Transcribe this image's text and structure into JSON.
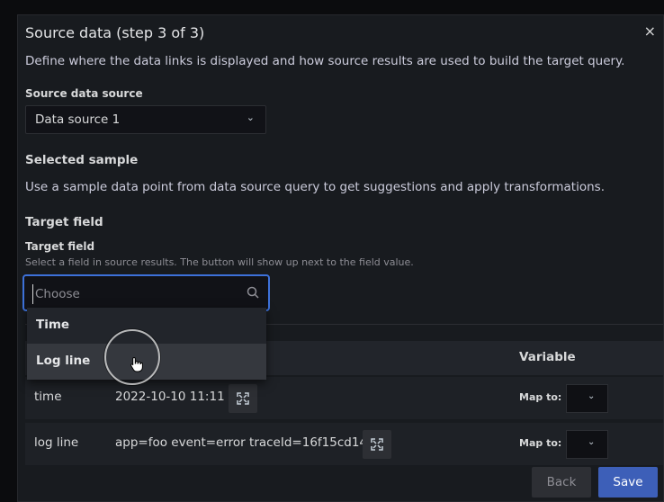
{
  "modal": {
    "title": "Source data (step 3 of 3)",
    "close_label": "×",
    "description": "Define where the data links is displayed and how source results are used to build the target query."
  },
  "source_data_source": {
    "label": "Source data source",
    "selected": "Data source 1"
  },
  "selected_sample": {
    "heading": "Selected sample",
    "text": "Use a sample data point from data source query to get suggestions and apply transformations."
  },
  "target_field": {
    "heading": "Target field",
    "label": "Target field",
    "hint": "Select a field in source results. The button will show up next to the field value.",
    "placeholder": "Choose",
    "options": [
      "Time",
      "Log line"
    ],
    "hovered_option": "Log line"
  },
  "table": {
    "columns": [
      "Variable"
    ],
    "rows": [
      {
        "field": "time",
        "value": "2022-10-10 11:11",
        "map_label": "Map to:"
      },
      {
        "field": "log line",
        "value": "app=foo event=error traceId=16f15cd14",
        "map_label": "Map to:"
      }
    ]
  },
  "footer": {
    "back_label": "Back",
    "save_label": "Save"
  },
  "colors": {
    "accent": "#3d71d9",
    "primary_button": "#3d5fb8"
  }
}
